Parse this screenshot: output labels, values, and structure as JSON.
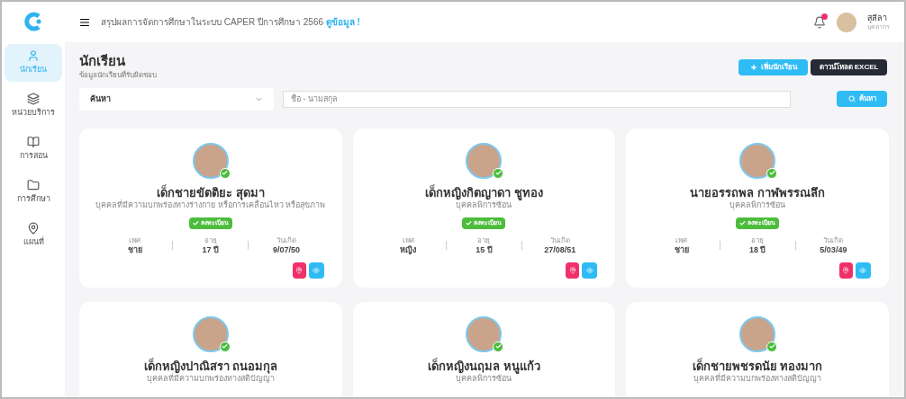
{
  "header": {
    "announcement": "สรุปผลการจัดการศึกษาในระบบ CAPER ปีการศึกษา 2566",
    "link": "ดูข้อมูล !",
    "user": {
      "name": "สุลีลา",
      "role": "บุคลากร"
    },
    "notification": true
  },
  "sidebar": {
    "items": [
      {
        "label": "นักเรียน",
        "selected": true
      },
      {
        "label": "หน่วยบริการ",
        "selected": false
      },
      {
        "label": "การสอน",
        "selected": false
      },
      {
        "label": "การศึกษา",
        "selected": false
      },
      {
        "label": "แผนที่",
        "selected": false
      }
    ]
  },
  "page": {
    "title": "นักเรียน",
    "subtitle": "ข้อมูลนักเรียนที่รับผิดชอบ",
    "buttons": [
      {
        "label": "เพิ่มนักเรียน",
        "kind": "add"
      },
      {
        "label": "ดาวน์โหลด EXCEL",
        "kind": "dark"
      }
    ]
  },
  "search": {
    "select": "ค้นหา",
    "placeholder": "ชื่อ - นามสกุล",
    "button": "ค้นหา"
  },
  "students": [
    {
      "name": "เด็กชายขัตติยะ สุดมา",
      "description": "บุคคลที่มีความบกพร่องทางร่างกาย หรือการเคลื่อนไหว หรือสุขภาพ",
      "badge": "ลงทะเบียน",
      "verified": true,
      "stats": [
        {
          "label": "เพศ",
          "value": "ชาย"
        },
        {
          "label": "อายุ",
          "value": "17 ปี"
        },
        {
          "label": "วันเกิด",
          "value": "9/07/50"
        }
      ]
    },
    {
      "name": "เด็กหญิงกิตญาดา ชูทอง",
      "description": "บุคคลพิการซ้อน",
      "badge": "ลงทะเบียน",
      "verified": true,
      "stats": [
        {
          "label": "เพศ",
          "value": "หญิง"
        },
        {
          "label": "อายุ",
          "value": "15 ปี"
        },
        {
          "label": "วันเกิด",
          "value": "27/08/51"
        }
      ]
    },
    {
      "name": "นายอรรถพล กาฬพรรณลึก",
      "description": "บุคคลพิการซ้อน",
      "badge": "ลงทะเบียน",
      "verified": true,
      "stats": [
        {
          "label": "เพศ",
          "value": "ชาย"
        },
        {
          "label": "อายุ",
          "value": "18 ปี"
        },
        {
          "label": "วันเกิด",
          "value": "5/03/49"
        }
      ]
    },
    {
      "name": "เด็กหญิงปาณิสรา ถนอมกุล",
      "description": "บุคคลที่มีความบกพร่องทางสติปัญญา",
      "verified": true
    },
    {
      "name": "เด็กหญิงนฤมล หนูแก้ว",
      "description": "บุคคลพิการซ้อน",
      "verified": true
    },
    {
      "name": "เด็กชายพชรดนัย ทองมาก",
      "description": "บุคคลที่มีความบกพร่องทางสติปัญญา",
      "verified": true
    }
  ]
}
